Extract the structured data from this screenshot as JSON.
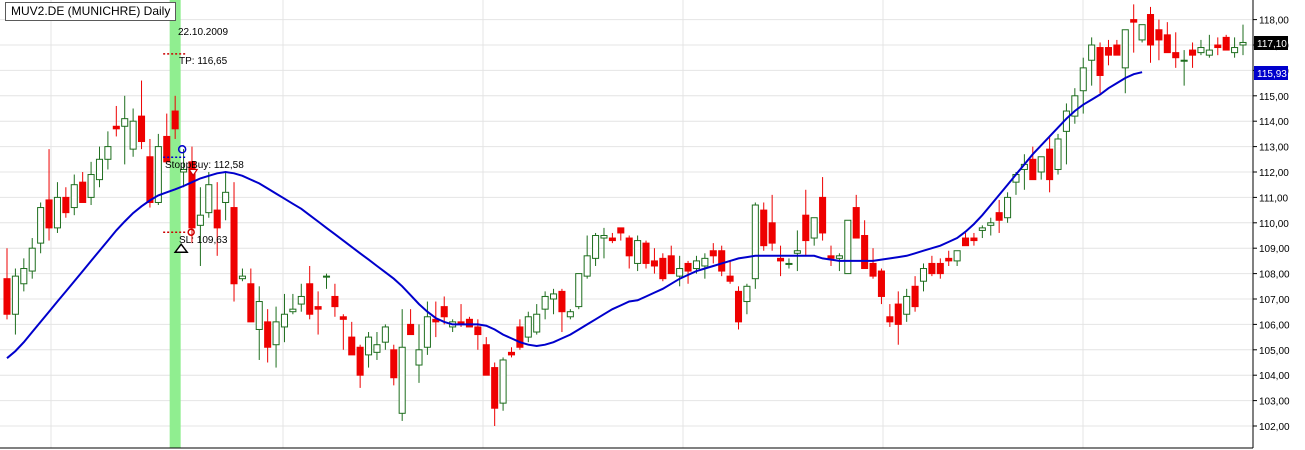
{
  "chart_title": "MUV2.DE (MUNICHRE) Daily",
  "colors": {
    "background": "#ffffff",
    "grid": "#e4e4e4",
    "up_candle_body": "#ffffff",
    "up_candle_border": "#1e6e1e",
    "down_candle": "#ee0000",
    "moving_average": "#0000cc",
    "entry_bar_highlight": "#90ee90",
    "last_price_label_bg": "#000000",
    "ma_label_bg": "#0000cc"
  },
  "annotations": {
    "date_label": "22.10.2009",
    "tp_label": "TP: 116,65",
    "stopbuy_label": "StoppBuy: 112,58",
    "sl_label": "SL: 109,63"
  },
  "price_labels": {
    "last_price": "117,10",
    "moving_average": "115,93"
  },
  "chart_data": {
    "type": "candlestick",
    "title": "MUV2.DE (MUNICHRE) Daily",
    "y_axis": {
      "position": "right",
      "range": [
        101.6,
        118.4
      ],
      "ticks": [
        "102,00",
        "103,00",
        "104,00",
        "105,00",
        "106,00",
        "107,00",
        "108,00",
        "109,00",
        "110,00",
        "111,00",
        "112,00",
        "113,00",
        "114,00",
        "115,00",
        "116,00",
        "117,00",
        "118,00"
      ]
    },
    "grid": true,
    "highlighted_bar_index": 20,
    "trade_levels": {
      "take_profit": 116.65,
      "stop_buy": 112.58,
      "stop_loss": 109.63
    },
    "candles": [
      [
        107.8,
        109.0,
        106.2,
        106.4
      ],
      [
        106.4,
        108.2,
        105.6,
        107.9
      ],
      [
        107.6,
        108.6,
        107.3,
        108.2
      ],
      [
        108.1,
        109.4,
        107.8,
        109.0
      ],
      [
        109.2,
        110.8,
        108.8,
        110.6
      ],
      [
        110.9,
        112.9,
        109.3,
        109.8
      ],
      [
        109.8,
        111.6,
        109.6,
        111.0
      ],
      [
        111.0,
        111.4,
        110.2,
        110.4
      ],
      [
        110.6,
        111.9,
        110.3,
        111.5
      ],
      [
        111.6,
        112.0,
        110.8,
        110.8
      ],
      [
        111.0,
        112.4,
        110.7,
        111.9
      ],
      [
        111.7,
        113.0,
        111.4,
        112.5
      ],
      [
        112.5,
        113.6,
        112.1,
        113.0
      ],
      [
        113.8,
        114.6,
        113.4,
        113.7
      ],
      [
        113.8,
        115.0,
        112.3,
        114.1
      ],
      [
        112.9,
        114.5,
        112.6,
        114.0
      ],
      [
        114.2,
        115.6,
        112.9,
        113.2
      ],
      [
        112.6,
        113.3,
        110.6,
        110.8
      ],
      [
        110.8,
        113.5,
        110.7,
        113.0
      ],
      [
        113.4,
        114.3,
        112.6,
        112.4
      ],
      [
        114.4,
        115.0,
        113.3,
        113.7
      ],
      [
        112.0,
        112.9,
        111.4,
        112.1
      ],
      [
        112.4,
        113.0,
        109.2,
        109.8
      ],
      [
        109.9,
        111.4,
        108.3,
        110.3
      ],
      [
        110.4,
        112.0,
        110.2,
        111.5
      ],
      [
        110.5,
        111.6,
        108.7,
        109.8
      ],
      [
        110.8,
        112.0,
        110.1,
        111.2
      ],
      [
        110.6,
        111.6,
        106.9,
        107.6
      ],
      [
        107.8,
        108.2,
        107.7,
        107.9
      ],
      [
        107.6,
        108.2,
        106.2,
        106.1
      ],
      [
        105.8,
        107.5,
        104.6,
        106.9
      ],
      [
        106.1,
        106.6,
        104.5,
        105.1
      ],
      [
        105.2,
        106.7,
        104.3,
        106.1
      ],
      [
        105.9,
        107.2,
        105.3,
        106.4
      ],
      [
        106.5,
        107.2,
        106.4,
        106.6
      ],
      [
        106.8,
        107.6,
        106.5,
        107.1
      ],
      [
        107.6,
        108.3,
        106.2,
        106.4
      ],
      [
        106.7,
        107.3,
        105.6,
        106.6
      ],
      [
        107.9,
        108.0,
        107.4,
        107.9
      ],
      [
        107.1,
        107.6,
        106.3,
        106.7
      ],
      [
        106.3,
        106.4,
        105.0,
        106.2
      ],
      [
        105.5,
        106.1,
        105.1,
        104.8
      ],
      [
        105.1,
        105.2,
        103.5,
        104.0
      ],
      [
        104.8,
        105.7,
        104.3,
        105.5
      ],
      [
        104.9,
        105.7,
        104.6,
        105.2
      ],
      [
        105.3,
        106.0,
        105.0,
        105.9
      ],
      [
        105.0,
        105.2,
        103.6,
        103.9
      ],
      [
        102.5,
        106.6,
        102.2,
        105.1
      ],
      [
        106.0,
        106.6,
        105.6,
        105.6
      ],
      [
        104.4,
        106.0,
        103.7,
        105.0
      ],
      [
        105.1,
        106.9,
        104.8,
        106.3
      ],
      [
        106.2,
        106.9,
        105.5,
        106.1
      ],
      [
        106.7,
        107.1,
        106.0,
        106.3
      ],
      [
        105.9,
        106.2,
        105.7,
        106.1
      ],
      [
        106.1,
        106.8,
        105.9,
        106.0
      ],
      [
        106.2,
        106.3,
        105.9,
        105.9
      ],
      [
        105.9,
        106.2,
        105.0,
        105.6
      ],
      [
        105.2,
        105.5,
        104.1,
        104.0
      ],
      [
        104.3,
        104.5,
        102.0,
        102.7
      ],
      [
        102.9,
        104.7,
        102.6,
        104.6
      ],
      [
        104.9,
        105.1,
        104.7,
        104.8
      ],
      [
        105.9,
        106.2,
        105.0,
        105.1
      ],
      [
        105.5,
        106.5,
        105.3,
        106.3
      ],
      [
        105.7,
        106.8,
        105.6,
        106.4
      ],
      [
        106.6,
        107.3,
        106.2,
        107.1
      ],
      [
        107.0,
        107.4,
        106.4,
        107.2
      ],
      [
        107.3,
        107.4,
        105.7,
        106.5
      ],
      [
        106.3,
        106.6,
        106.2,
        106.5
      ],
      [
        106.7,
        108.0,
        106.6,
        108.0
      ],
      [
        107.9,
        109.5,
        107.8,
        108.7
      ],
      [
        108.6,
        109.6,
        108.3,
        109.5
      ],
      [
        109.4,
        109.8,
        108.6,
        109.5
      ],
      [
        109.4,
        109.6,
        109.2,
        109.3
      ],
      [
        109.8,
        109.6,
        109.3,
        109.6
      ],
      [
        109.4,
        109.5,
        108.2,
        108.7
      ],
      [
        108.4,
        109.5,
        108.1,
        109.3
      ],
      [
        109.2,
        109.3,
        108.2,
        108.4
      ],
      [
        108.5,
        109.0,
        108.0,
        108.3
      ],
      [
        108.6,
        108.8,
        107.7,
        107.8
      ],
      [
        108.7,
        109.1,
        108.4,
        108.0
      ],
      [
        107.9,
        108.7,
        107.5,
        108.2
      ],
      [
        108.4,
        108.5,
        107.6,
        108.1
      ],
      [
        108.2,
        108.7,
        108.0,
        108.5
      ],
      [
        108.3,
        108.8,
        107.8,
        108.6
      ],
      [
        108.9,
        109.2,
        108.4,
        108.7
      ],
      [
        108.9,
        109.1,
        107.9,
        108.1
      ],
      [
        107.9,
        108.5,
        107.6,
        107.7
      ],
      [
        107.3,
        107.5,
        105.8,
        106.1
      ],
      [
        106.9,
        107.6,
        106.4,
        107.5
      ],
      [
        107.8,
        110.8,
        107.4,
        110.7
      ],
      [
        110.5,
        110.8,
        108.9,
        109.1
      ],
      [
        110.0,
        111.1,
        108.9,
        109.2
      ],
      [
        108.6,
        109.1,
        107.9,
        108.5
      ],
      [
        108.4,
        108.6,
        108.2,
        108.4
      ],
      [
        108.8,
        109.7,
        108.1,
        108.9
      ],
      [
        110.3,
        111.3,
        108.7,
        109.3
      ],
      [
        109.4,
        110.0,
        109.1,
        110.2
      ],
      [
        111.0,
        111.8,
        109.3,
        109.6
      ],
      [
        108.7,
        109.1,
        108.3,
        108.6
      ],
      [
        108.6,
        108.8,
        108.1,
        108.7
      ],
      [
        108.0,
        109.1,
        108.0,
        110.1
      ],
      [
        110.6,
        111.1,
        109.6,
        109.4
      ],
      [
        109.5,
        110.1,
        108.9,
        108.2
      ],
      [
        108.4,
        109.0,
        107.8,
        107.9
      ],
      [
        108.1,
        108.2,
        106.8,
        107.1
      ],
      [
        106.3,
        106.8,
        105.9,
        106.1
      ],
      [
        106.8,
        107.3,
        105.2,
        106.0
      ],
      [
        106.4,
        107.4,
        106.1,
        107.1
      ],
      [
        107.5,
        107.9,
        106.5,
        106.7
      ],
      [
        107.7,
        108.4,
        107.3,
        108.2
      ],
      [
        108.4,
        108.7,
        107.9,
        108.0
      ],
      [
        108.4,
        108.6,
        107.8,
        108.0
      ],
      [
        108.6,
        108.9,
        108.3,
        108.5
      ],
      [
        108.5,
        108.8,
        108.3,
        108.9
      ],
      [
        109.4,
        109.6,
        109.2,
        109.1
      ],
      [
        109.4,
        109.6,
        109.1,
        109.3
      ],
      [
        109.7,
        109.9,
        109.4,
        109.8
      ],
      [
        109.9,
        110.2,
        109.5,
        110.0
      ],
      [
        110.4,
        110.9,
        109.6,
        110.1
      ],
      [
        110.2,
        111.2,
        110.0,
        111.0
      ],
      [
        111.6,
        112.0,
        111.1,
        111.9
      ],
      [
        112.1,
        112.7,
        111.3,
        112.3
      ],
      [
        112.5,
        113.0,
        112.1,
        111.7
      ],
      [
        112.0,
        112.6,
        111.7,
        112.6
      ],
      [
        112.9,
        113.4,
        111.2,
        111.7
      ],
      [
        112.1,
        113.5,
        111.9,
        113.3
      ],
      [
        113.6,
        114.7,
        112.3,
        114.4
      ],
      [
        114.2,
        115.3,
        113.9,
        115.0
      ],
      [
        115.2,
        116.5,
        114.3,
        116.1
      ],
      [
        116.4,
        117.3,
        115.4,
        117.0
      ],
      [
        116.9,
        117.1,
        115.1,
        115.8
      ],
      [
        116.9,
        117.2,
        116.2,
        116.6
      ],
      [
        117.0,
        117.2,
        116.6,
        116.6
      ],
      [
        116.1,
        117.0,
        115.1,
        117.6
      ],
      [
        118.0,
        118.6,
        116.7,
        117.9
      ],
      [
        117.2,
        117.6,
        117.1,
        117.8
      ],
      [
        118.2,
        118.5,
        116.3,
        117.0
      ],
      [
        117.6,
        118.0,
        116.4,
        117.2
      ],
      [
        117.4,
        117.9,
        116.7,
        116.7
      ],
      [
        116.7,
        117.5,
        116.1,
        116.5
      ],
      [
        116.4,
        116.8,
        115.4,
        116.4
      ],
      [
        116.8,
        117.1,
        116.1,
        116.6
      ],
      [
        116.7,
        117.2,
        116.6,
        116.9
      ],
      [
        116.6,
        117.4,
        116.5,
        116.8
      ],
      [
        117.0,
        117.3,
        116.6,
        116.9
      ],
      [
        117.3,
        117.4,
        116.8,
        116.8
      ],
      [
        116.7,
        117.3,
        116.5,
        116.9
      ],
      [
        117.0,
        117.8,
        116.6,
        117.1
      ]
    ],
    "moving_average": {
      "name": "",
      "values": [
        104.67,
        104.95,
        105.3,
        105.7,
        106.1,
        106.5,
        106.9,
        107.3,
        107.7,
        108.1,
        108.5,
        108.9,
        109.3,
        109.7,
        110.05,
        110.38,
        110.65,
        110.88,
        111.08,
        111.2,
        111.32,
        111.45,
        111.6,
        111.75,
        111.85,
        111.95,
        112.0,
        111.95,
        111.85,
        111.7,
        111.55,
        111.35,
        111.15,
        110.95,
        110.75,
        110.55,
        110.3,
        110.05,
        109.8,
        109.55,
        109.3,
        109.05,
        108.8,
        108.55,
        108.3,
        108.05,
        107.8,
        107.5,
        107.15,
        106.8,
        106.5,
        106.25,
        106.1,
        106.0,
        106.0,
        106.0,
        106.0,
        105.95,
        105.8,
        105.6,
        105.45,
        105.3,
        105.2,
        105.15,
        105.2,
        105.3,
        105.45,
        105.6,
        105.8,
        106.0,
        106.2,
        106.4,
        106.6,
        106.75,
        106.9,
        106.95,
        107.1,
        107.25,
        107.4,
        107.6,
        107.8,
        107.95,
        108.1,
        108.2,
        108.3,
        108.4,
        108.5,
        108.6,
        108.65,
        108.7,
        108.7,
        108.7,
        108.7,
        108.7,
        108.7,
        108.7,
        108.7,
        108.6,
        108.55,
        108.5,
        108.5,
        108.5,
        108.5,
        108.5,
        108.55,
        108.6,
        108.65,
        108.7,
        108.8,
        108.9,
        109.0,
        109.1,
        109.25,
        109.4,
        109.65,
        109.95,
        110.3,
        110.7,
        111.1,
        111.5,
        111.9,
        112.3,
        112.7,
        113.05,
        113.4,
        113.75,
        114.1,
        114.4,
        114.65,
        114.85,
        115.05,
        115.3,
        115.5,
        115.7,
        115.85,
        115.93
      ]
    }
  }
}
